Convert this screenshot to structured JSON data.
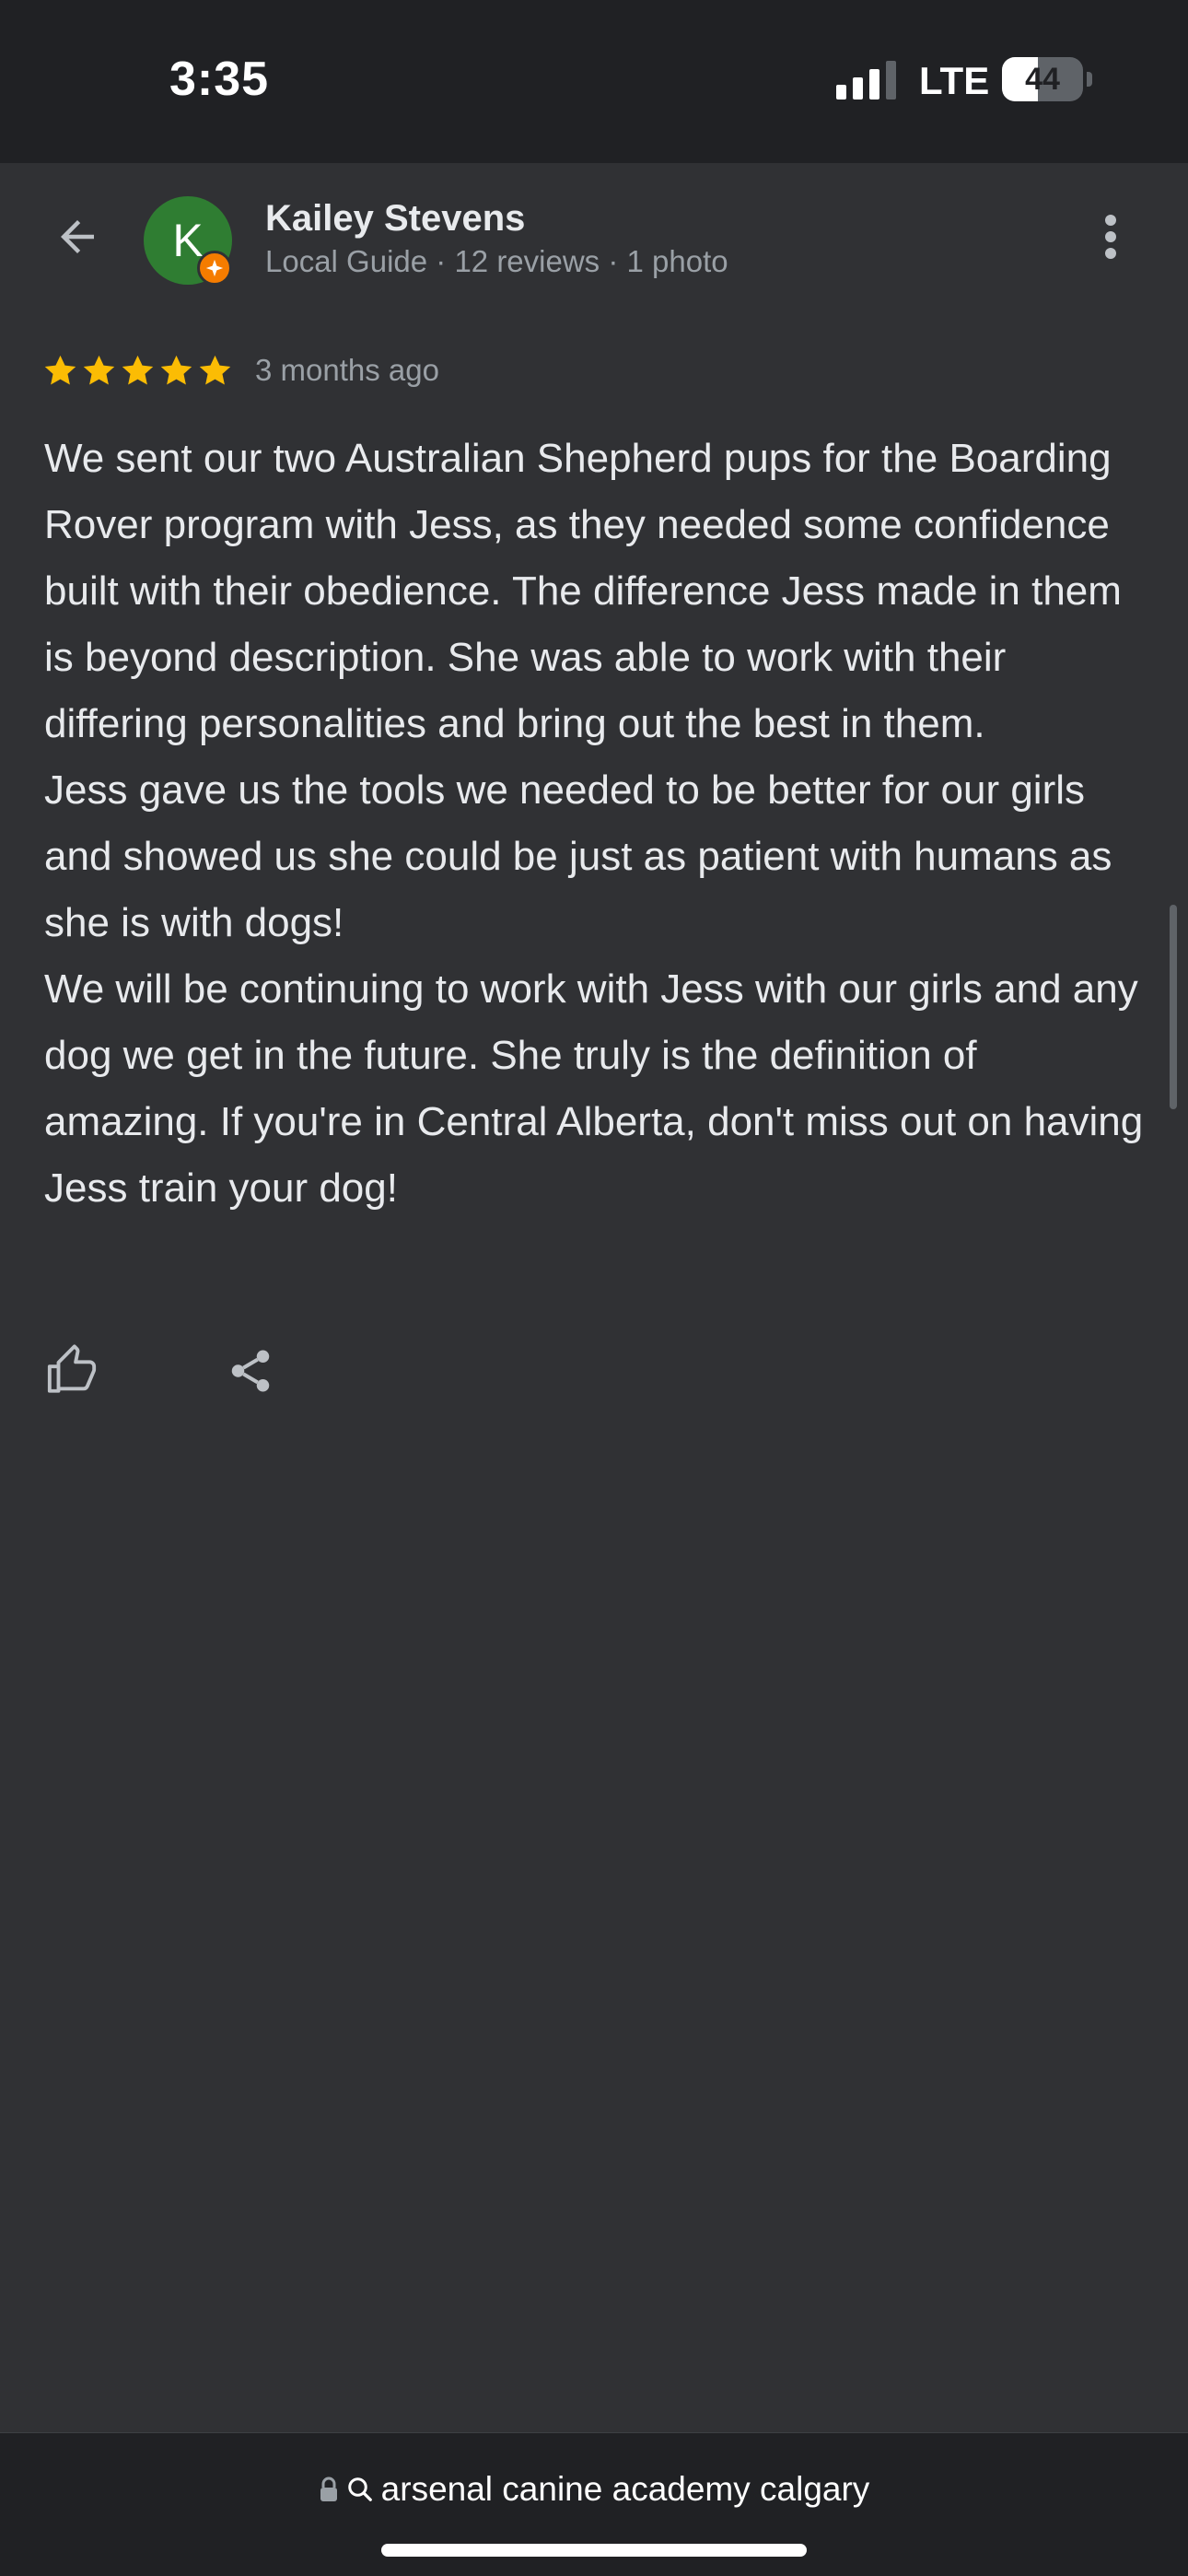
{
  "status_bar": {
    "time": "3:35",
    "network": "LTE",
    "battery": "44",
    "battery_level_percent": 44
  },
  "review": {
    "reviewer_name": "Kailey Stevens",
    "reviewer_meta": "Local Guide · 12 reviews · 1 photo",
    "avatar_initial": "K",
    "avatar_color": "#2f7d32",
    "badge_color": "#f57c00",
    "rating": 5,
    "star_color": "#fbbc04",
    "date": "3 months ago",
    "paragraphs": [
      "We sent our two Australian Shepherd pups for the Boarding Rover program with Jess, as they needed some confidence built with their obedience. The difference Jess made in them is beyond description. She was able to work with their differing personalities and bring out the best in them.",
      "Jess gave us the tools we needed to be better for our girls and showed us she could be just as patient with humans as she is with dogs!",
      "We will be continuing to work with Jess with our girls and any dog we get in the future. She truly is the definition of amazing. If you're in Central Alberta, don't miss out on having Jess train your dog!"
    ]
  },
  "icons": {
    "back": "arrow-left-icon",
    "more": "more-vert-icon",
    "like": "thumb-up-icon",
    "share": "share-icon",
    "lock": "lock-icon",
    "search": "search-icon"
  },
  "browser": {
    "url_text": "arsenal canine academy calgary"
  }
}
